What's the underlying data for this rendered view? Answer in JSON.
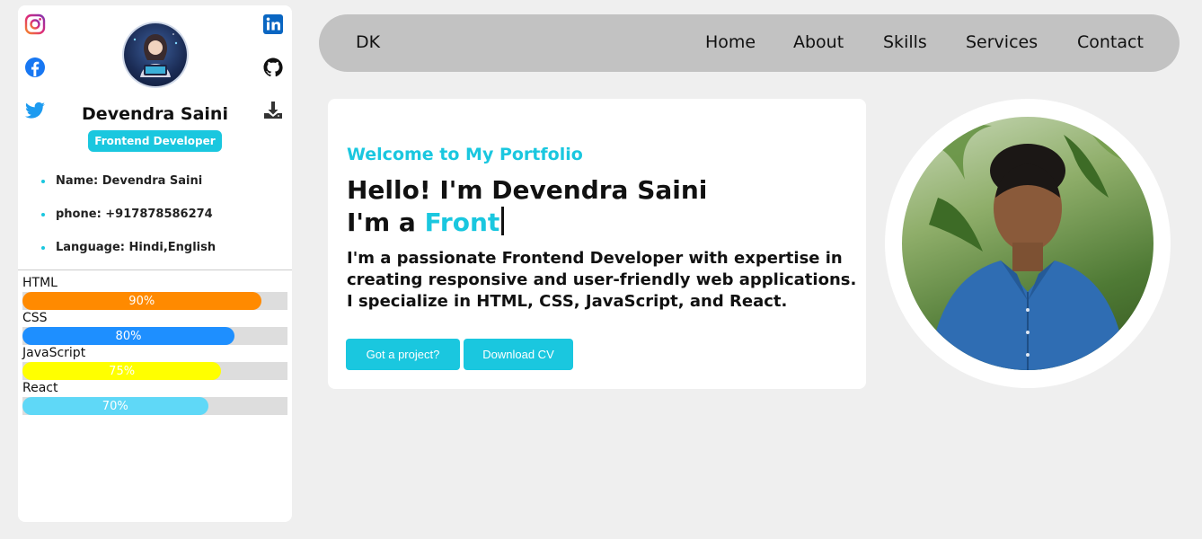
{
  "sidebar": {
    "name": "Devendra Saini",
    "role_badge": "Frontend Developer",
    "info": [
      {
        "text": "Name: Devendra Saini"
      },
      {
        "text": "phone: +917878586274"
      },
      {
        "text": "Language: Hindi,English"
      }
    ],
    "skills": [
      {
        "label": "HTML",
        "percent": 90,
        "percent_text": "90%",
        "color": "#ff8a00"
      },
      {
        "label": "CSS",
        "percent": 80,
        "percent_text": "80%",
        "color": "#1e8fff"
      },
      {
        "label": "JavaScript",
        "percent": 75,
        "percent_text": "75%",
        "color": "#ffff00"
      },
      {
        "label": "React",
        "percent": 70,
        "percent_text": "70%",
        "color": "#5fd8f7"
      }
    ],
    "social_icons": [
      "instagram-icon",
      "linkedin-icon",
      "facebook-icon",
      "github-icon",
      "twitter-icon",
      "download-icon"
    ]
  },
  "navbar": {
    "logo": "DK",
    "items": [
      "Home",
      "About",
      "Skills",
      "Services",
      "Contact"
    ]
  },
  "hero": {
    "welcome": "Welcome to My Portfolio",
    "hello": "Hello! I'm Devendra Saini",
    "iam_prefix": "I'm a ",
    "typed": "Front",
    "description": "I'm a passionate Frontend Developer with expertise in creating responsive and user-friendly web applications. I specialize in HTML, CSS, JavaScript, and React.",
    "buttons": {
      "project": "Got a project?",
      "cv": "Download CV"
    }
  },
  "colors": {
    "accent": "#1ac7df",
    "navbar": "#c2c2c2",
    "background": "#efefef"
  }
}
